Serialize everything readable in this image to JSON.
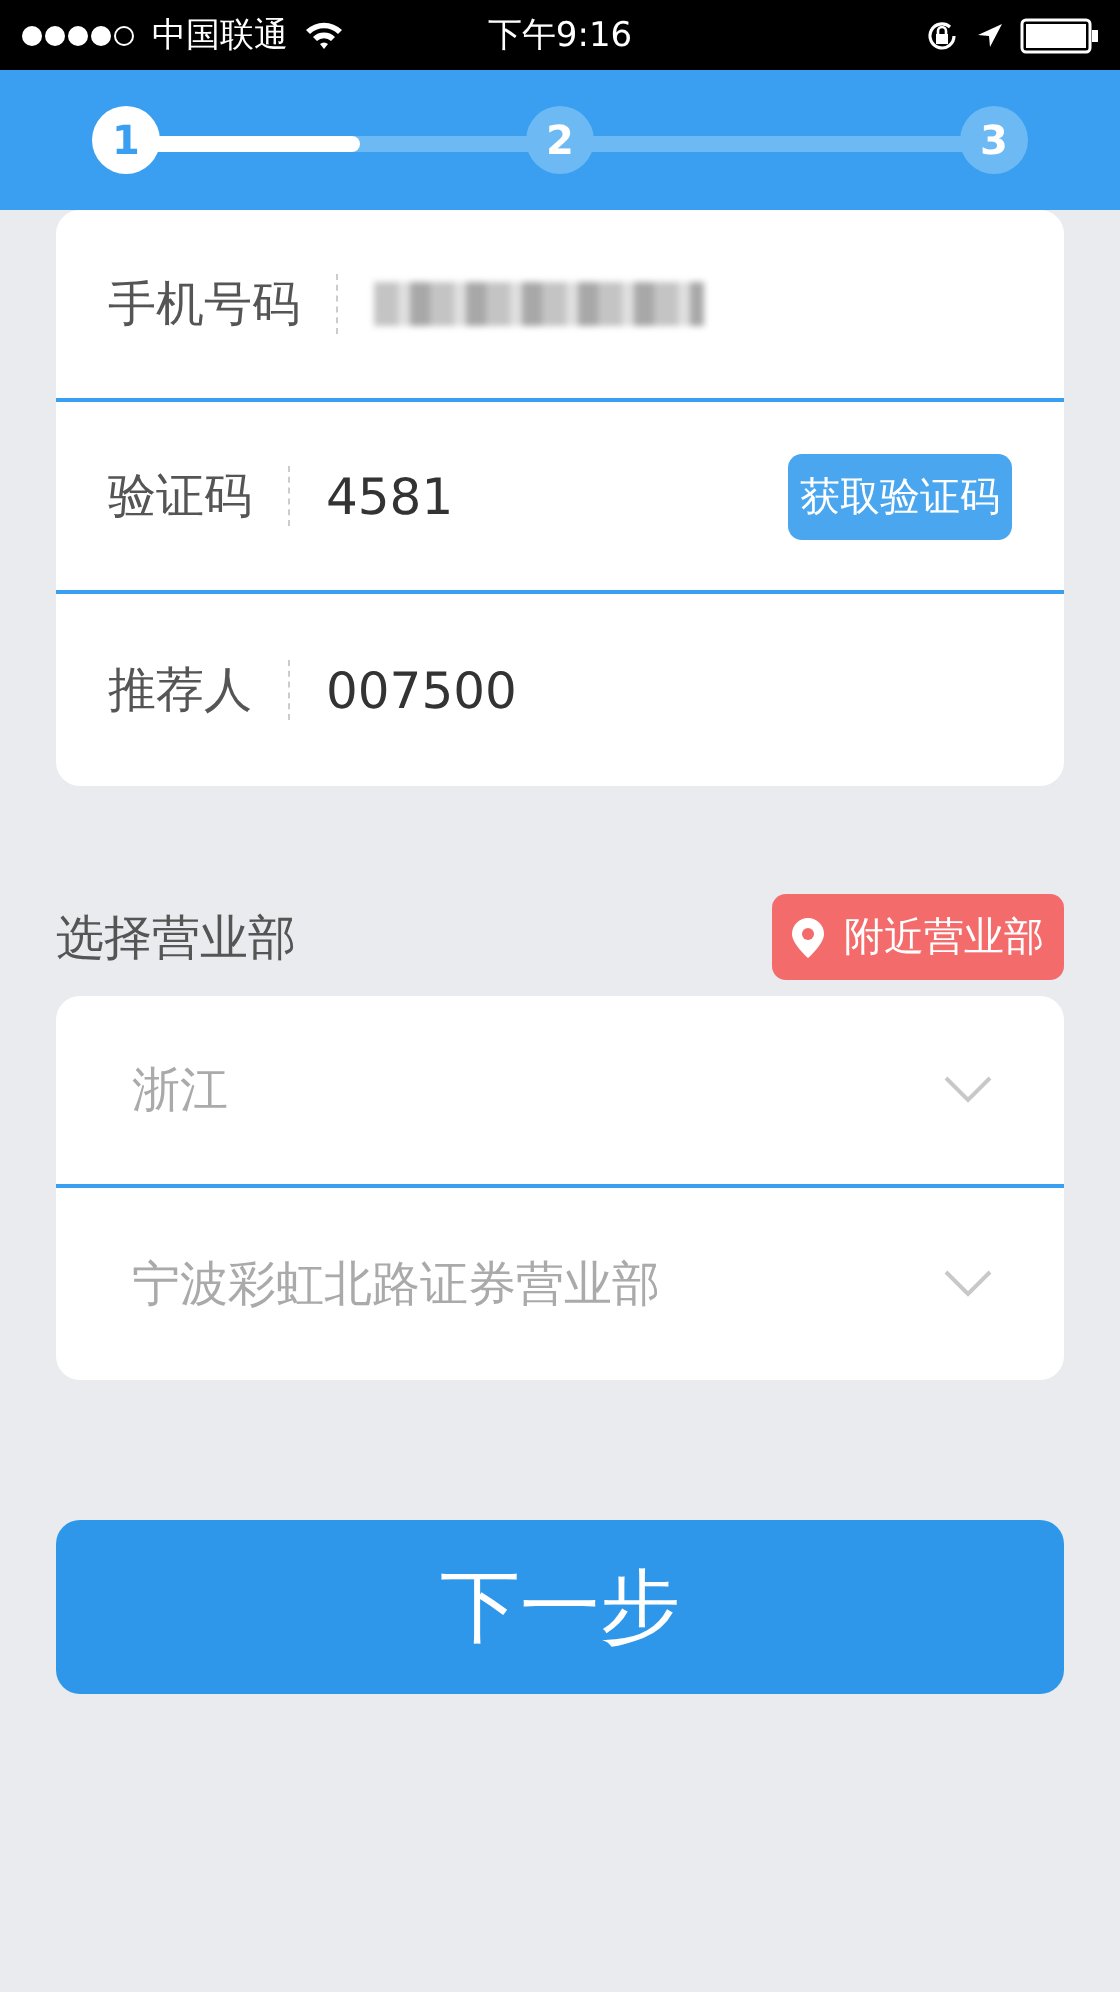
{
  "status_bar": {
    "carrier": "中国联通",
    "time": "下午9:16"
  },
  "stepper": {
    "level": 0.27,
    "steps": [
      {
        "label": "1",
        "selected": true
      },
      {
        "label": "2",
        "selected": false
      },
      {
        "label": "3",
        "selected": false
      }
    ]
  },
  "form": {
    "rows": [
      {
        "kind": "masked",
        "label": "手机号码"
      },
      {
        "kind": "text",
        "label": "验证码",
        "value": "4581",
        "button": "获取验证码"
      },
      {
        "kind": "text",
        "label": "推荐人",
        "value": "007500"
      }
    ]
  },
  "branch": {
    "title": "选择营业部",
    "nearby_button": "附近营业部",
    "selects": [
      {
        "value": "浙江"
      },
      {
        "value": "宁波彩虹北路证券营业部"
      }
    ]
  },
  "next_button": "下一步"
}
